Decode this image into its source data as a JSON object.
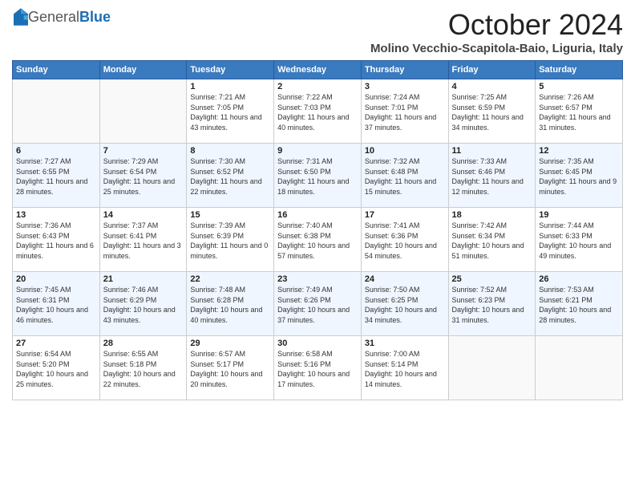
{
  "header": {
    "logo_general": "General",
    "logo_blue": "Blue",
    "month_title": "October 2024",
    "location": "Molino Vecchio-Scapitola-Baio, Liguria, Italy"
  },
  "days_of_week": [
    "Sunday",
    "Monday",
    "Tuesday",
    "Wednesday",
    "Thursday",
    "Friday",
    "Saturday"
  ],
  "weeks": [
    [
      {
        "day": "",
        "info": ""
      },
      {
        "day": "",
        "info": ""
      },
      {
        "day": "1",
        "info": "Sunrise: 7:21 AM\nSunset: 7:05 PM\nDaylight: 11 hours and 43 minutes."
      },
      {
        "day": "2",
        "info": "Sunrise: 7:22 AM\nSunset: 7:03 PM\nDaylight: 11 hours and 40 minutes."
      },
      {
        "day": "3",
        "info": "Sunrise: 7:24 AM\nSunset: 7:01 PM\nDaylight: 11 hours and 37 minutes."
      },
      {
        "day": "4",
        "info": "Sunrise: 7:25 AM\nSunset: 6:59 PM\nDaylight: 11 hours and 34 minutes."
      },
      {
        "day": "5",
        "info": "Sunrise: 7:26 AM\nSunset: 6:57 PM\nDaylight: 11 hours and 31 minutes."
      }
    ],
    [
      {
        "day": "6",
        "info": "Sunrise: 7:27 AM\nSunset: 6:55 PM\nDaylight: 11 hours and 28 minutes."
      },
      {
        "day": "7",
        "info": "Sunrise: 7:29 AM\nSunset: 6:54 PM\nDaylight: 11 hours and 25 minutes."
      },
      {
        "day": "8",
        "info": "Sunrise: 7:30 AM\nSunset: 6:52 PM\nDaylight: 11 hours and 22 minutes."
      },
      {
        "day": "9",
        "info": "Sunrise: 7:31 AM\nSunset: 6:50 PM\nDaylight: 11 hours and 18 minutes."
      },
      {
        "day": "10",
        "info": "Sunrise: 7:32 AM\nSunset: 6:48 PM\nDaylight: 11 hours and 15 minutes."
      },
      {
        "day": "11",
        "info": "Sunrise: 7:33 AM\nSunset: 6:46 PM\nDaylight: 11 hours and 12 minutes."
      },
      {
        "day": "12",
        "info": "Sunrise: 7:35 AM\nSunset: 6:45 PM\nDaylight: 11 hours and 9 minutes."
      }
    ],
    [
      {
        "day": "13",
        "info": "Sunrise: 7:36 AM\nSunset: 6:43 PM\nDaylight: 11 hours and 6 minutes."
      },
      {
        "day": "14",
        "info": "Sunrise: 7:37 AM\nSunset: 6:41 PM\nDaylight: 11 hours and 3 minutes."
      },
      {
        "day": "15",
        "info": "Sunrise: 7:39 AM\nSunset: 6:39 PM\nDaylight: 11 hours and 0 minutes."
      },
      {
        "day": "16",
        "info": "Sunrise: 7:40 AM\nSunset: 6:38 PM\nDaylight: 10 hours and 57 minutes."
      },
      {
        "day": "17",
        "info": "Sunrise: 7:41 AM\nSunset: 6:36 PM\nDaylight: 10 hours and 54 minutes."
      },
      {
        "day": "18",
        "info": "Sunrise: 7:42 AM\nSunset: 6:34 PM\nDaylight: 10 hours and 51 minutes."
      },
      {
        "day": "19",
        "info": "Sunrise: 7:44 AM\nSunset: 6:33 PM\nDaylight: 10 hours and 49 minutes."
      }
    ],
    [
      {
        "day": "20",
        "info": "Sunrise: 7:45 AM\nSunset: 6:31 PM\nDaylight: 10 hours and 46 minutes."
      },
      {
        "day": "21",
        "info": "Sunrise: 7:46 AM\nSunset: 6:29 PM\nDaylight: 10 hours and 43 minutes."
      },
      {
        "day": "22",
        "info": "Sunrise: 7:48 AM\nSunset: 6:28 PM\nDaylight: 10 hours and 40 minutes."
      },
      {
        "day": "23",
        "info": "Sunrise: 7:49 AM\nSunset: 6:26 PM\nDaylight: 10 hours and 37 minutes."
      },
      {
        "day": "24",
        "info": "Sunrise: 7:50 AM\nSunset: 6:25 PM\nDaylight: 10 hours and 34 minutes."
      },
      {
        "day": "25",
        "info": "Sunrise: 7:52 AM\nSunset: 6:23 PM\nDaylight: 10 hours and 31 minutes."
      },
      {
        "day": "26",
        "info": "Sunrise: 7:53 AM\nSunset: 6:21 PM\nDaylight: 10 hours and 28 minutes."
      }
    ],
    [
      {
        "day": "27",
        "info": "Sunrise: 6:54 AM\nSunset: 5:20 PM\nDaylight: 10 hours and 25 minutes."
      },
      {
        "day": "28",
        "info": "Sunrise: 6:55 AM\nSunset: 5:18 PM\nDaylight: 10 hours and 22 minutes."
      },
      {
        "day": "29",
        "info": "Sunrise: 6:57 AM\nSunset: 5:17 PM\nDaylight: 10 hours and 20 minutes."
      },
      {
        "day": "30",
        "info": "Sunrise: 6:58 AM\nSunset: 5:16 PM\nDaylight: 10 hours and 17 minutes."
      },
      {
        "day": "31",
        "info": "Sunrise: 7:00 AM\nSunset: 5:14 PM\nDaylight: 10 hours and 14 minutes."
      },
      {
        "day": "",
        "info": ""
      },
      {
        "day": "",
        "info": ""
      }
    ]
  ]
}
